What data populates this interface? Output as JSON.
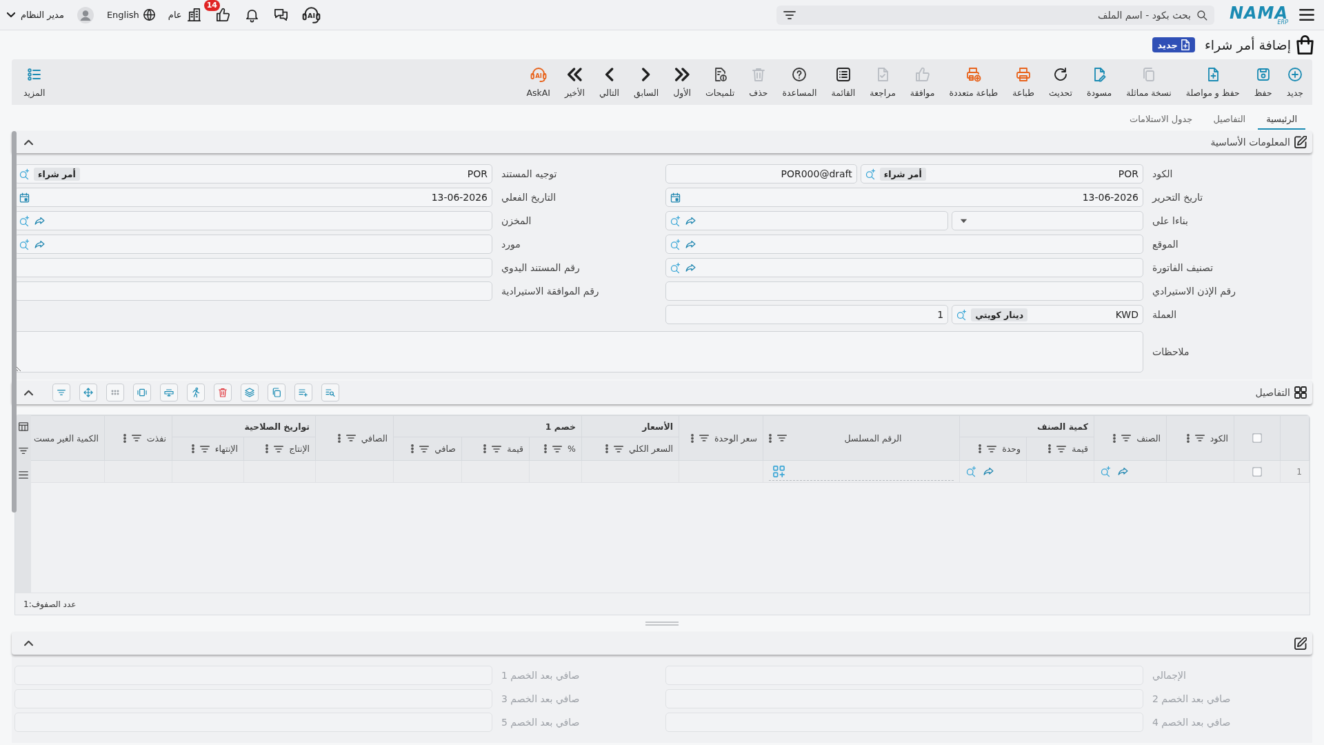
{
  "top_bar": {
    "logo": {
      "name": "NAMA",
      "subtitle": "ERP"
    },
    "search": {
      "placeholder": "بحث بكود - اسم الملف"
    },
    "assistant_icon_text": "AI",
    "notifications_badge": "14",
    "company": "عام",
    "language": "English",
    "user": "مدير النظام"
  },
  "page": {
    "title": "إضافة أمر شراء",
    "status_badge": "جديد"
  },
  "toolbar": [
    {
      "label": "جديد",
      "color": "#1a8bb3",
      "disabled": false
    },
    {
      "label": "حفظ",
      "color": "#1a8bb3",
      "disabled": false
    },
    {
      "label": "حفظ و مواصلة",
      "color": "#1a8bb3",
      "disabled": false
    },
    {
      "label": "نسخة مماثلة",
      "disabled": true
    },
    {
      "label": "مسودة",
      "color": "#1a8bb3",
      "disabled": false
    },
    {
      "label": "تحديث",
      "color": "#1f1f1f",
      "disabled": false
    },
    {
      "label": "طباعة",
      "color": "#e8621a",
      "disabled": false
    },
    {
      "label": "طباعة متعددة",
      "color": "#e8621a",
      "disabled": false
    },
    {
      "label": "موافقة",
      "disabled": true
    },
    {
      "label": "مراجعة",
      "disabled": true
    },
    {
      "label": "القائمة",
      "color": "#1f1f1f",
      "disabled": false
    },
    {
      "label": "المساعدة",
      "color": "#333333",
      "disabled": false
    },
    {
      "label": "حذف",
      "disabled": true
    },
    {
      "label": "تلميحات",
      "color": "#444444",
      "disabled": false
    },
    {
      "label": "الأول",
      "color": "#1f1f1f",
      "disabled": false
    },
    {
      "label": "السابق",
      "color": "#1f1f1f",
      "disabled": false
    },
    {
      "label": "التالي",
      "color": "#1f1f1f",
      "disabled": false
    },
    {
      "label": "الأخير",
      "color": "#1f1f1f",
      "disabled": false
    },
    {
      "label": "AskAI",
      "color": "#e8621a",
      "disabled": false,
      "icon_text": "AI"
    }
  ],
  "more_button": {
    "label": "المزيد"
  },
  "tabs": [
    {
      "label": "الرئيسية",
      "selected": true
    },
    {
      "label": "التفاصيل",
      "selected": false
    },
    {
      "label": "جدول الاستلامات",
      "selected": false
    }
  ],
  "basic_info": {
    "title": "المعلومات الأساسية",
    "expanded": true,
    "right_column": [
      {
        "label": "الكود",
        "controls": [
          {
            "kind": "lookup",
            "value": "POR",
            "tag": "أمر شراء"
          },
          {
            "kind": "text",
            "value": "POR000@draft"
          }
        ]
      },
      {
        "label": "تاريخ التحرير",
        "controls": [
          {
            "kind": "date",
            "value": "13-06-2026"
          }
        ]
      },
      {
        "label": "بناءا على",
        "controls": [
          {
            "kind": "select"
          },
          {
            "kind": "link"
          }
        ]
      },
      {
        "label": "الموقع",
        "controls": [
          {
            "kind": "link"
          }
        ]
      },
      {
        "label": "تصنيف الفاتورة",
        "controls": [
          {
            "kind": "link"
          }
        ]
      },
      {
        "label": "رقم الإذن الاستيرادي",
        "controls": [
          {
            "kind": "text"
          }
        ]
      },
      {
        "label": "العملة",
        "controls": [
          {
            "kind": "lookup",
            "value": "KWD",
            "tag": "دينار كويتي"
          },
          {
            "kind": "text",
            "value": "1"
          }
        ]
      }
    ],
    "left_column": [
      {
        "label": "توجيه المستند",
        "controls": [
          {
            "kind": "lookup",
            "value": "POR",
            "tag": "أمر شراء"
          }
        ]
      },
      {
        "label": "التاريخ الفعلي",
        "controls": [
          {
            "kind": "date",
            "value": "13-06-2026"
          }
        ]
      },
      {
        "label": "المخزن",
        "controls": [
          {
            "kind": "link"
          }
        ]
      },
      {
        "label": "مورد",
        "controls": [
          {
            "kind": "link"
          }
        ]
      },
      {
        "label": "رقم المستند اليدوي",
        "controls": [
          {
            "kind": "text"
          }
        ]
      },
      {
        "label": "رقم الموافقة الاستيرادية",
        "controls": [
          {
            "kind": "text"
          }
        ]
      }
    ],
    "notes": {
      "label": "ملاحظات"
    }
  },
  "details": {
    "title": "التفاصيل",
    "expanded": true,
    "grid": {
      "select_all": {
        "checked": false
      },
      "columns": [
        {
          "label": "الكود",
          "kind": "text"
        },
        {
          "label": "الصنف",
          "kind": "lookup"
        },
        {
          "group": "كمية الصنف",
          "columns": [
            {
              "label": "قيمة",
              "kind": "text"
            },
            {
              "label": "وحدة",
              "kind": "lookup"
            }
          ]
        },
        {
          "label": "الرقم المسلسل",
          "kind": "serial"
        },
        {
          "label": "سعر الوحدة",
          "kind": "text"
        },
        {
          "group": "الأسعار",
          "columns": [
            {
              "label": "السعر الكلي",
              "kind": "text"
            }
          ]
        },
        {
          "group": "خصم 1",
          "columns": [
            {
              "label": "%",
              "kind": "text"
            },
            {
              "label": "قيمة",
              "kind": "text"
            },
            {
              "label": "صافي",
              "kind": "text"
            }
          ]
        },
        {
          "label": "الصافي",
          "kind": "text"
        },
        {
          "group": "تواريخ الصلاحية",
          "columns": [
            {
              "label": "الإنتاج",
              "kind": "text"
            },
            {
              "label": "الإنتهاء",
              "kind": "text"
            }
          ]
        },
        {
          "label": "نفذت",
          "kind": "text"
        },
        {
          "label": "الكمية الغير مست",
          "kind": "text"
        }
      ],
      "rows": [
        {
          "number": "1",
          "selected": false
        }
      ],
      "row_count": "عدد الصفوف:1"
    }
  },
  "summary": {
    "expanded": true,
    "right_column": [
      {
        "label": "الإجمالي",
        "disabled": true
      },
      {
        "label": "صافي بعد الخصم 2",
        "disabled": true
      },
      {
        "label": "صافي بعد الخصم 4",
        "disabled": true
      }
    ],
    "left_column": [
      {
        "label": "صافي بعد الخصم 1",
        "disabled": true
      },
      {
        "label": "صافي بعد الخصم 3",
        "disabled": true
      },
      {
        "label": "صافي بعد الخصم 5",
        "disabled": true
      }
    ]
  }
}
